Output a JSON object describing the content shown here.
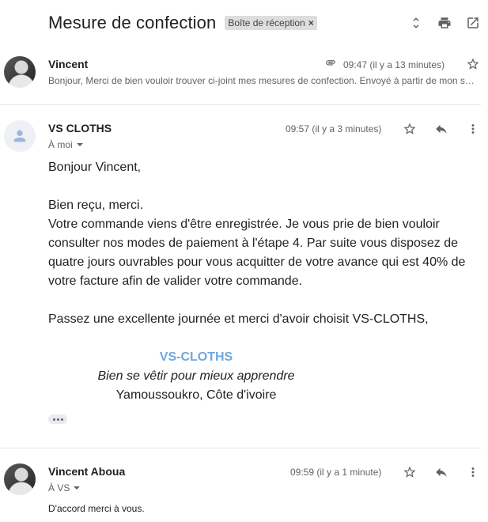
{
  "header": {
    "subject": "Mesure de confection",
    "label": "Boîte de réception",
    "label_remove": "×",
    "icons": [
      "expand-collapse-icon",
      "print-icon",
      "open-in-new-window-icon"
    ]
  },
  "messages": [
    {
      "sender": "Vincent",
      "time": "09:47 (il y a 13 minutes)",
      "has_attachment": true,
      "snippet": "Bonjour, Merci de bien vouloir trouver ci-joint mes mesures de confection. Envoyé à partir de mon smartphone",
      "avatar": "photo"
    },
    {
      "sender": "VS CLOTHS",
      "time": "09:57 (il y a 3 minutes)",
      "recipient": "À moi",
      "avatar": "placeholder",
      "body": {
        "greeting": "Bonjour Vincent,",
        "para1_line1": "Bien reçu, merci.",
        "para1_rest": "Votre commande viens d'être enregistrée. Je vous prie de bien vouloir consulter nos modes de paiement à l'étape 4. Par suite vous disposez de quatre jours ouvrables pour vous acquitter de votre avance qui est 40% de votre facture afin de valider votre commande.",
        "closing": "Passez une excellente journée et merci d'avoir choisit VS-CLOTHS,",
        "sig_brand": "VS-CLOTHS",
        "sig_tagline": "Bien se vêtir pour mieux apprendre",
        "sig_location": "Yamoussoukro, Côte d'ivoire"
      }
    },
    {
      "sender": "Vincent Aboua",
      "time": "09:59 (il y a 1 minute)",
      "recipient": "À VS",
      "avatar": "photo",
      "snippet": "D'accord merci à vous."
    }
  ],
  "colors": {
    "brand_signature": "#6fa8dc",
    "secondary_text": "#5f6368",
    "label_chip": "#dddddd"
  }
}
